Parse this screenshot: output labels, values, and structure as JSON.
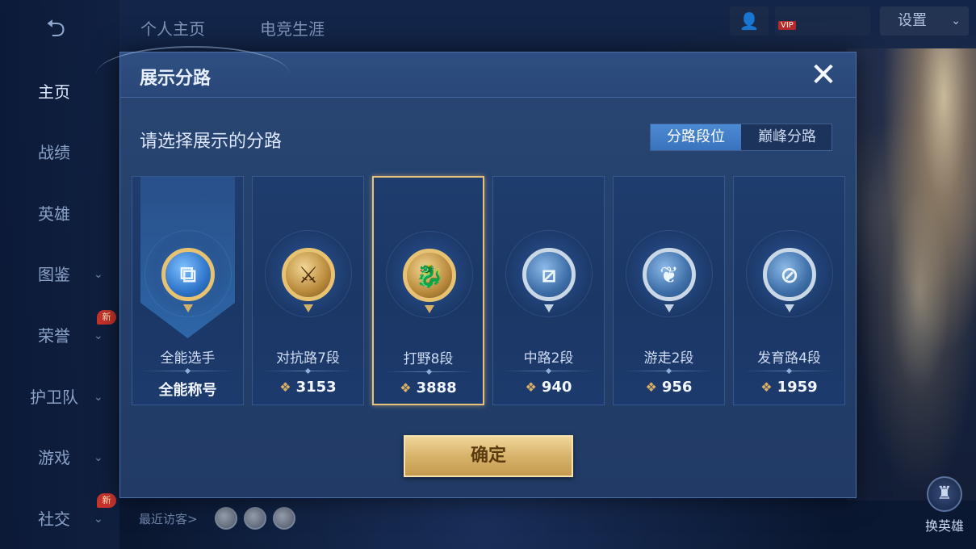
{
  "sidebar": {
    "back_label": "⮌",
    "items": [
      {
        "label": "主页",
        "active": true,
        "chevron": false,
        "new": false
      },
      {
        "label": "战绩",
        "active": false,
        "chevron": false,
        "new": false
      },
      {
        "label": "英雄",
        "active": false,
        "chevron": false,
        "new": false
      },
      {
        "label": "图鉴",
        "active": false,
        "chevron": true,
        "new": false
      },
      {
        "label": "荣誉",
        "active": false,
        "chevron": true,
        "new": true
      },
      {
        "label": "护卫队",
        "active": false,
        "chevron": true,
        "new": false
      },
      {
        "label": "游戏",
        "active": false,
        "chevron": true,
        "new": false
      },
      {
        "label": "社交",
        "active": false,
        "chevron": true,
        "new": true
      }
    ],
    "new_badge": "新"
  },
  "top_tabs": [
    "个人主页",
    "电竞生涯"
  ],
  "top_right": {
    "vip_label": "VIP",
    "settings_label": "设置"
  },
  "visitors_label": "最近访客>",
  "right_icons": {
    "swap_hero": "换英雄"
  },
  "modal": {
    "title": "展示分路",
    "close_icon": "✕",
    "prompt": "请选择展示的分路",
    "toggle": [
      "分路段位",
      "巅峰分路"
    ],
    "cards": [
      {
        "name": "全能选手",
        "score": "全能称号",
        "has_star": false,
        "selected": false,
        "style": "gold-blue",
        "glyph": "⧉",
        "banner": true
      },
      {
        "name": "对抗路7段",
        "score": "3153",
        "has_star": true,
        "selected": false,
        "style": "gold",
        "glyph": "⚔",
        "banner": false
      },
      {
        "name": "打野8段",
        "score": "3888",
        "has_star": true,
        "selected": true,
        "style": "gold",
        "glyph": "🐉",
        "banner": false
      },
      {
        "name": "中路2段",
        "score": "940",
        "has_star": true,
        "selected": false,
        "style": "silver",
        "glyph": "⧄",
        "banner": false
      },
      {
        "name": "游走2段",
        "score": "956",
        "has_star": true,
        "selected": false,
        "style": "silver",
        "glyph": "❦",
        "banner": false
      },
      {
        "name": "发育路4段",
        "score": "1959",
        "has_star": true,
        "selected": false,
        "style": "silver",
        "glyph": "⊘",
        "banner": false
      }
    ],
    "star_icon": "❖",
    "confirm_label": "确定"
  }
}
